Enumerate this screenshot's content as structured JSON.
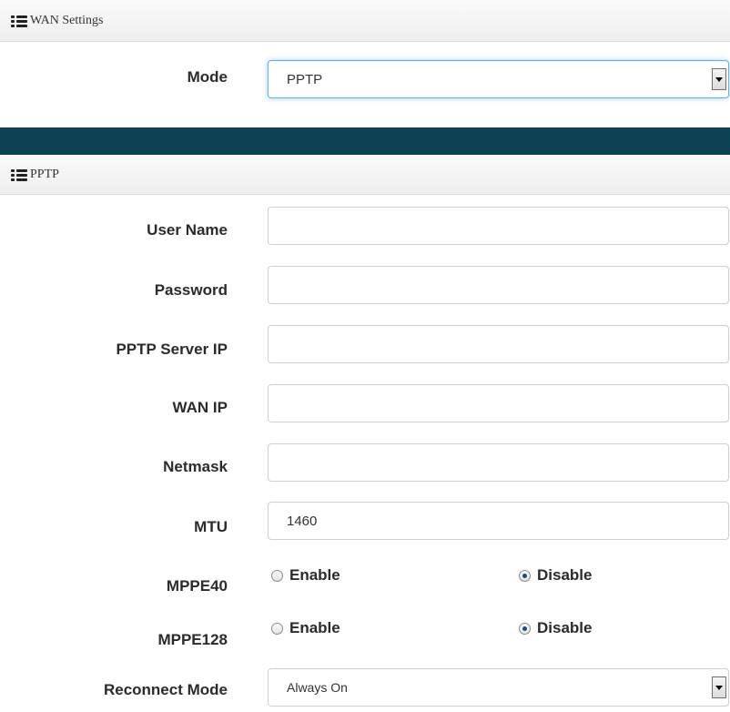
{
  "wan_settings": {
    "title": "WAN Settings"
  },
  "mode": {
    "label": "Mode",
    "value": "PPTP"
  },
  "pptp_section": {
    "title": "PPTP"
  },
  "fields": {
    "user_name": {
      "label": "User Name",
      "value": ""
    },
    "password": {
      "label": "Password",
      "value": ""
    },
    "pptp_server_ip": {
      "label": "PPTP Server IP",
      "value": ""
    },
    "wan_ip": {
      "label": "WAN IP",
      "value": ""
    },
    "netmask": {
      "label": "Netmask",
      "value": ""
    },
    "mtu": {
      "label": "MTU",
      "value": "1460"
    }
  },
  "mppe40": {
    "label": "MPPE40",
    "enable": "Enable",
    "disable": "Disable",
    "selected": "Disable"
  },
  "mppe128": {
    "label": "MPPE128",
    "enable": "Enable",
    "disable": "Disable",
    "selected": "Disable"
  },
  "reconnect_mode": {
    "label": "Reconnect Mode",
    "value": "Always On"
  },
  "colors": {
    "header_bar": "#0d4254",
    "focus_ring": "#66afe9"
  }
}
